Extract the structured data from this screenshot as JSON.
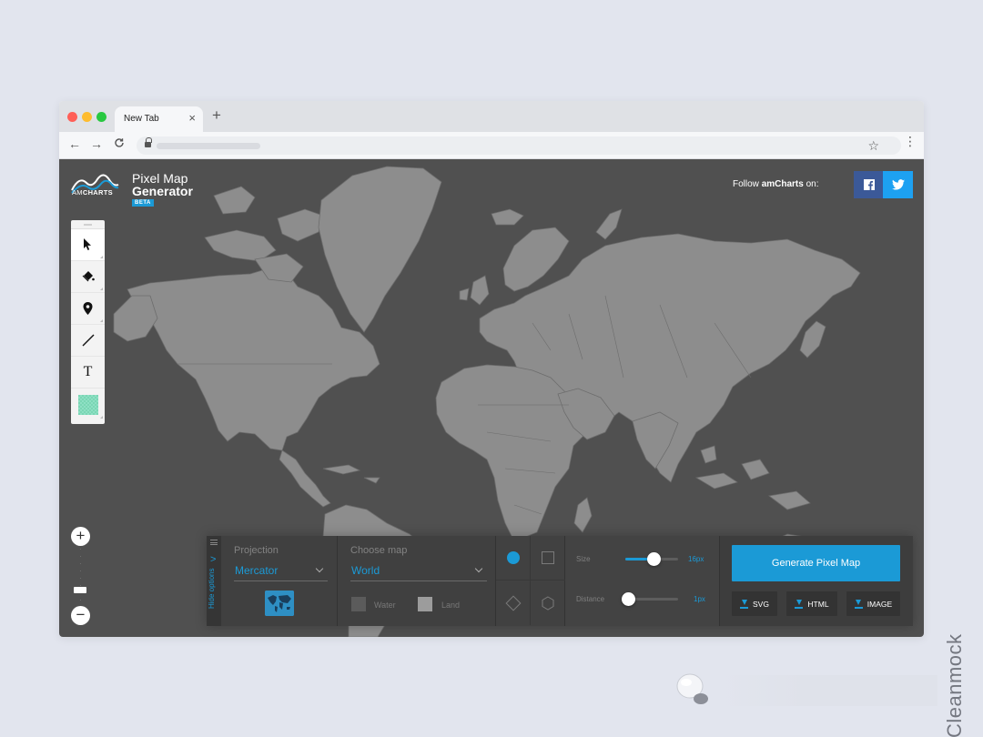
{
  "browser": {
    "tab_title": "New Tab",
    "tab_close": "×",
    "new_tab": "+",
    "nav_back": "←",
    "nav_forward": "→",
    "nav_reload": "C",
    "bookmark": "☆",
    "menu": "⋮"
  },
  "app": {
    "logo_am": "AM",
    "logo_charts": "CHARTS",
    "title": "Pixel Map",
    "subtitle": "Generator",
    "badge": "BETA",
    "follow_prefix": "Follow ",
    "follow_brand": "amCharts",
    "follow_suffix": " on:",
    "social": [
      "facebook-icon",
      "twitter-icon"
    ]
  },
  "tools": [
    "pointer-icon",
    "fill-bucket-icon",
    "map-pin-icon",
    "line-icon",
    "text-tool-icon",
    "color-swatch-icon"
  ],
  "tool_text_glyph": "T",
  "zoom": {
    "in": "+",
    "out": "−"
  },
  "panel": {
    "hide_label": "Hide options",
    "hide_chevron": ">",
    "projection_label": "Projection",
    "projection_value": "Mercator",
    "map_label": "Choose map",
    "map_value": "World",
    "water_label": "Water",
    "land_label": "Land",
    "size_label": "Size",
    "size_value": "16px",
    "distance_label": "Distance",
    "distance_value": "1px",
    "generate_label": "Generate Pixel Map",
    "downloads": [
      "SVG",
      "HTML",
      "IMAGE"
    ]
  },
  "colors": {
    "accent": "#1b9ad6",
    "map_bg": "#505050",
    "land": "#8d8d8d",
    "facebook": "#3b5998",
    "twitter": "#1da1f2"
  },
  "watermark": "Cleanmock"
}
